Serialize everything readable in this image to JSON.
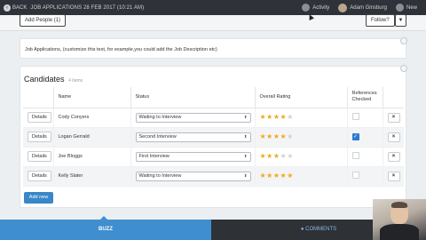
{
  "topbar": {
    "back_label": "BACK",
    "breadcrumb": "JOB APPLICATIONS 28 FEB 2017 (10:21 AM)",
    "activity_label": "Activity",
    "user_name": "Adam Ginsburg",
    "new_label": "New"
  },
  "subbar": {
    "add_people_label": "Add People (1)",
    "follow_label": "Follow?"
  },
  "description": {
    "text": "Job Applications, (customize this text, for example,you could add the Job Description etc)"
  },
  "candidates": {
    "title": "Candidates",
    "count": "4 items",
    "columns": [
      "",
      "Name",
      "Status",
      "Overall Rating",
      "References Checked",
      ""
    ],
    "rows": [
      {
        "details": "Details",
        "name": "Cody Conyers",
        "status": "Waiting to Interview",
        "rating": 4,
        "references_checked": false
      },
      {
        "details": "Details",
        "name": "Logan Gerrald",
        "status": "Second Interview",
        "rating": 4,
        "references_checked": true
      },
      {
        "details": "Details",
        "name": "Joe Bloggs",
        "status": "First Interview",
        "rating": 3,
        "references_checked": false
      },
      {
        "details": "Details",
        "name": "Kelly Slater",
        "status": "Waiting to Interview",
        "rating": 5,
        "references_checked": false
      }
    ],
    "add_new_label": "Add new",
    "remove_glyph": "×"
  },
  "bottom": {
    "buzz_label": "BUZZ",
    "comments_label": "COMMENTS"
  },
  "icons": {
    "back": "back-arrow-icon",
    "activity": "activity-icon",
    "new": "plus-icon",
    "caret": "caret-down-icon",
    "star": "star-icon",
    "comments": "comment-icon"
  },
  "colors": {
    "accent": "#3e8ed0",
    "star_filled": "#f0a81e",
    "star_empty": "#cfd2d6",
    "topbar": "#2f3238"
  }
}
